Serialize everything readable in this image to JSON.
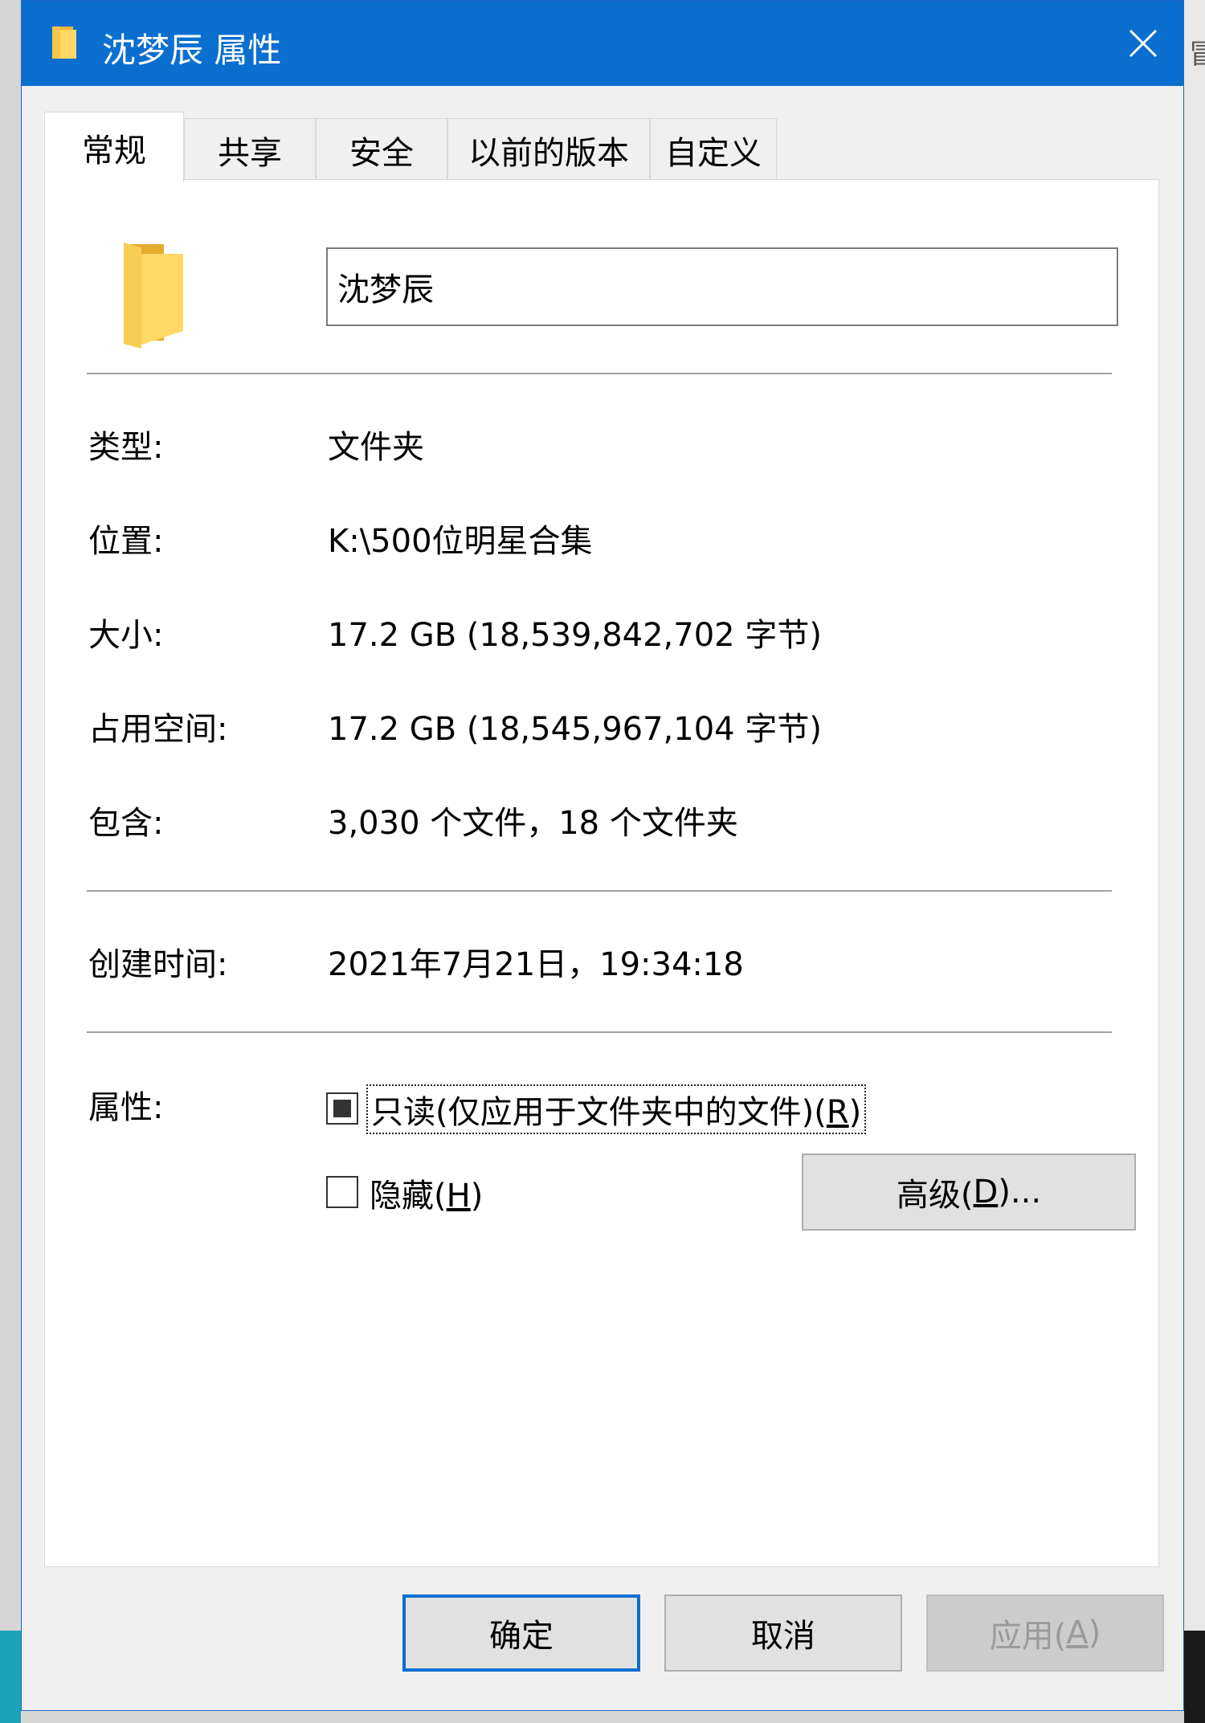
{
  "window": {
    "title": "沈梦辰 属性",
    "accent_color": "#0b6fd0"
  },
  "tabs": [
    {
      "label": "常规",
      "active": true
    },
    {
      "label": "共享",
      "active": false
    },
    {
      "label": "安全",
      "active": false
    },
    {
      "label": "以前的版本",
      "active": false
    },
    {
      "label": "自定义",
      "active": false
    }
  ],
  "general": {
    "folder_name": "沈梦辰",
    "type_label": "类型:",
    "type_value": "文件夹",
    "location_label": "位置:",
    "location_value": "K:\\500位明星合集",
    "size_label": "大小:",
    "size_value": "17.2 GB (18,539,842,702 字节)",
    "disk_size_label": "占用空间:",
    "disk_size_value": "17.2 GB (18,545,967,104 字节)",
    "contains_label": "包含:",
    "contains_value": "3,030 个文件，18 个文件夹",
    "created_label": "创建时间:",
    "created_value": "2021年7月21日，19:34:18",
    "attributes_label": "属性:",
    "readonly_label": "只读(仅应用于文件夹中的文件)(",
    "readonly_key": "R",
    "readonly_state": "indeterminate",
    "hidden_label": "隐藏(",
    "hidden_key": "H",
    "hidden_checked": false,
    "advanced_label": "高级(",
    "advanced_key": "D",
    "advanced_suffix": ")..."
  },
  "footer": {
    "ok_label": "确定",
    "cancel_label": "取消",
    "apply_label": "应用(",
    "apply_key": "A"
  },
  "icons": {
    "title": "folder-icon",
    "close": "close-icon",
    "big_folder": "folder-icon"
  }
}
